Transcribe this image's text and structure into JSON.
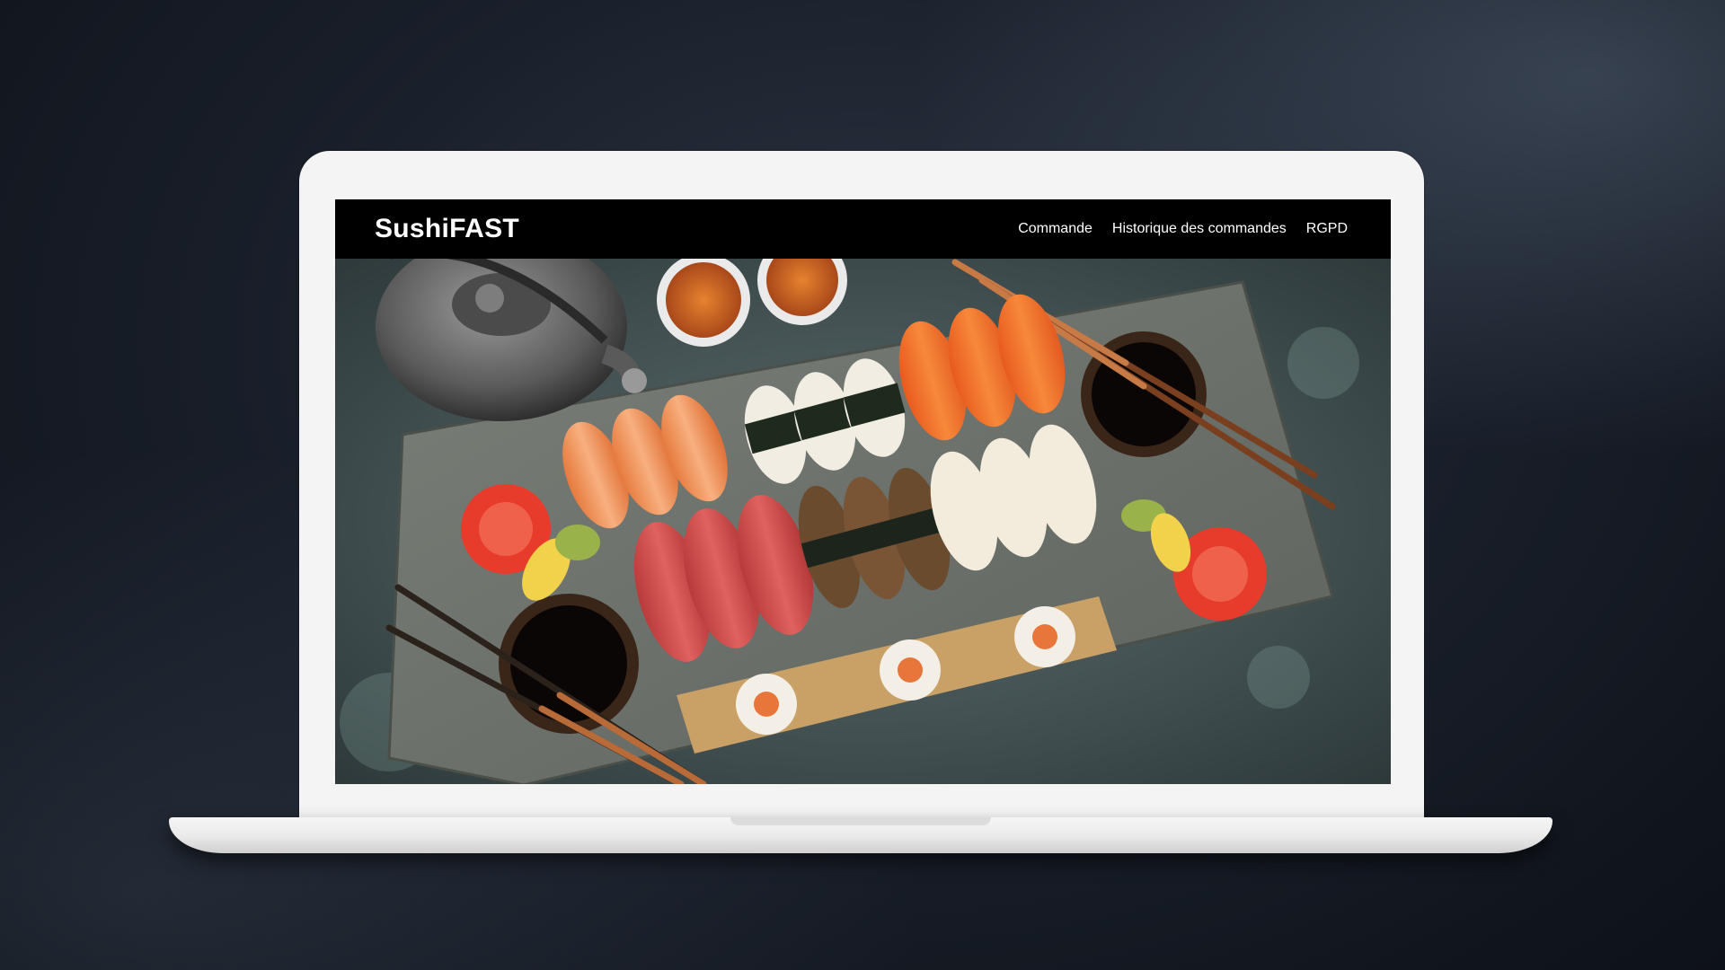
{
  "site": {
    "brand": "SushiFAST",
    "nav": [
      {
        "label": "Commande"
      },
      {
        "label": "Historique des commandes"
      },
      {
        "label": "RGPD"
      }
    ]
  },
  "hero": {
    "image_subject": "sushi platter on slate with teapot, tea cups, soy sauce bowls and chopsticks"
  },
  "colors": {
    "page_background": "#1a202b",
    "laptop_frame": "#f4f4f4",
    "nav_background": "#000000",
    "nav_text": "#ffffff"
  }
}
